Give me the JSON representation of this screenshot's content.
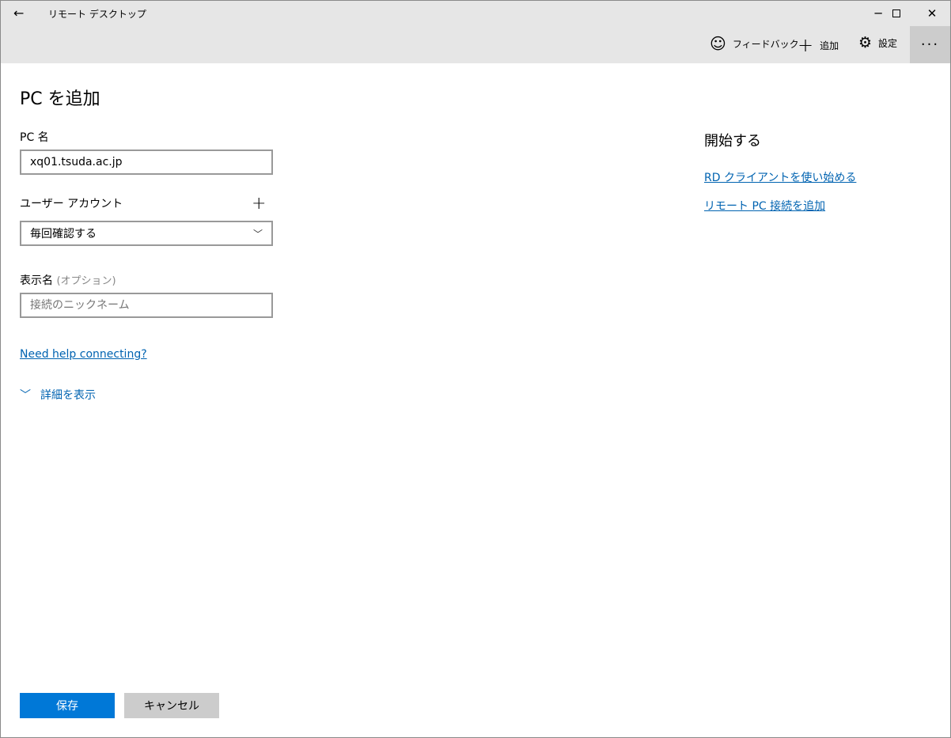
{
  "window": {
    "title": "リモート デスクトップ"
  },
  "commands": {
    "feedback": "フィードバック",
    "add": "追加",
    "settings": "設定",
    "more": "···"
  },
  "page": {
    "title": "PC を追加"
  },
  "form": {
    "pc_name_label": "PC 名",
    "pc_name_value": "xq01.tsuda.ac.jp",
    "user_account_label": "ユーザー アカウント",
    "user_account_value": "毎回確認する",
    "display_name_label": "表示名",
    "display_name_optional": "(オプション)",
    "display_name_placeholder": "接続のニックネーム",
    "help_link": "Need help connecting?",
    "show_details": "詳細を表示"
  },
  "side": {
    "title": "開始する",
    "links": [
      "RD クライアントを使い始める",
      "リモート PC 接続を追加"
    ]
  },
  "buttons": {
    "save": "保存",
    "cancel": "キャンセル"
  },
  "colors": {
    "accent": "#0078d7",
    "link": "#0063b1"
  }
}
